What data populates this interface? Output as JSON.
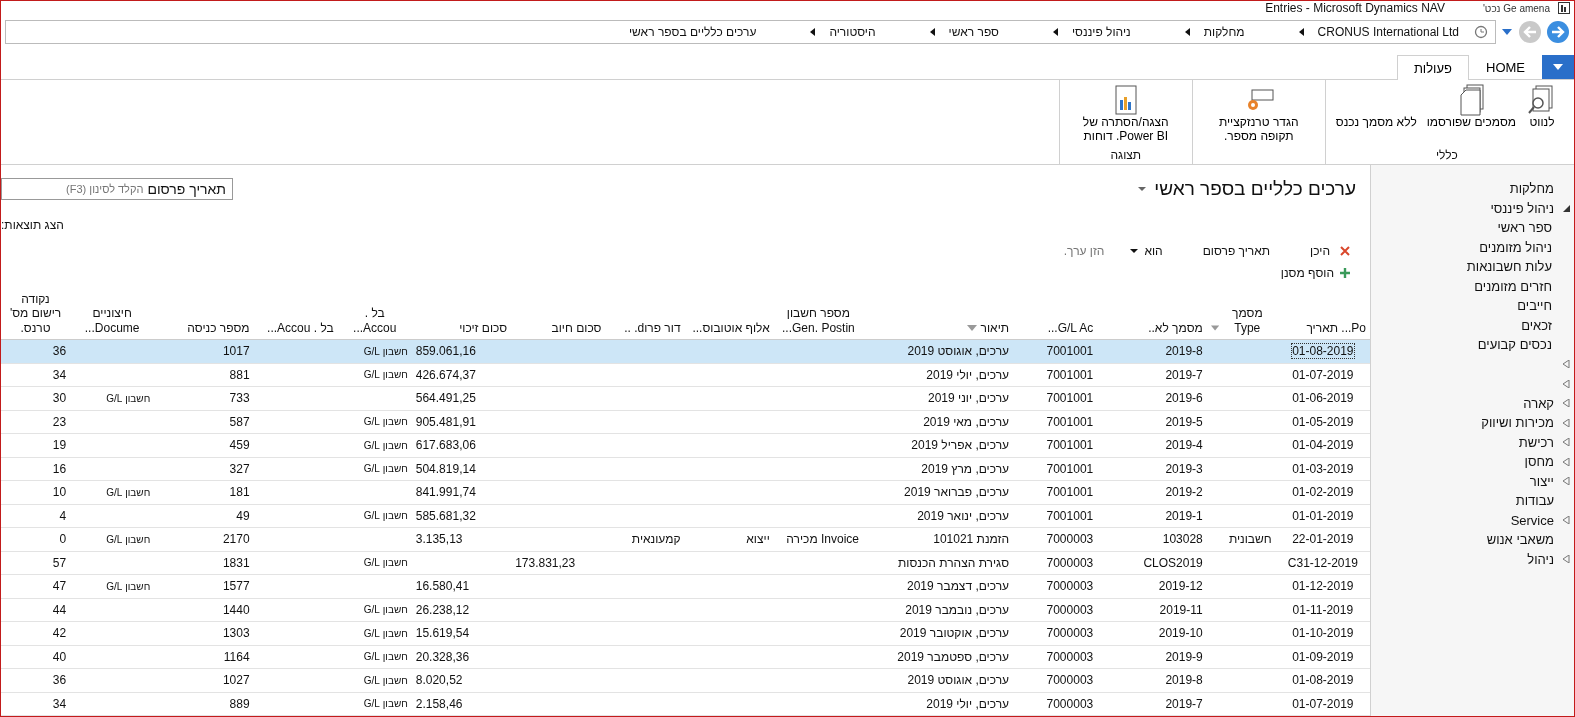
{
  "window": {
    "title": "Entries - Microsoft Dynamics NAV",
    "subtitle": "Ge amena נכט'"
  },
  "address_bar": {
    "crumbs": [
      "CRONUS International Ltd",
      "מחלקות",
      "ניהול פיננסי",
      "ספר ראשי",
      "היסטוריה",
      "ערכים כלליים בספר ראשי"
    ]
  },
  "ribbon": {
    "tabs": [
      {
        "label": "HOME",
        "selected": false
      },
      {
        "label": "פעולות",
        "selected": true
      }
    ],
    "groups": [
      {
        "label": "כללי",
        "buttons": [
          {
            "label": "לנווט"
          },
          {
            "label": "מסמכים שפורסמו"
          },
          {
            "label": "ללא מסמך נכנס"
          }
        ]
      },
      {
        "buttons": [
          {
            "label": "הגדר טרנזקציית תקופה מספר."
          }
        ]
      },
      {
        "label": "תצוגה",
        "buttons": [
          {
            "label": "הצגה/הסתרה של Power BI. דוחות"
          }
        ]
      }
    ]
  },
  "page": {
    "title": "ערכים כלליים בספר ראשי",
    "search": {
      "placeholder": "הקלד לסינון (F3)",
      "field": "תאריך פרסום"
    },
    "show_results": "הצג תוצאות:",
    "filter": {
      "where": "היכן",
      "field": "תאריך פרסום",
      "operator": "הוא",
      "value_placeholder": "הזן ערך.",
      "add": "הוסף מסנן"
    }
  },
  "table": {
    "columns": [
      {
        "label": "Po... תאריך",
        "sorted": false
      },
      {
        "label": "מסמך Type",
        "sorted": true
      },
      {
        "label": "מסמך לא..",
        "sorted": false
      },
      {
        "label": "G/L Ac...",
        "sorted": false
      },
      {
        "label": "תיאור",
        "sorted": true
      },
      {
        "label": "מספר חשבון Gen. Postin...",
        "sorted": false
      },
      {
        "label": "אלוף אוטובוס...",
        "sorted": false
      },
      {
        "label": "דור פרוd. ..",
        "sorted": false
      },
      {
        "label": "סכום חיוב",
        "sorted": false
      },
      {
        "label": "סכום זיכוי",
        "sorted": false
      },
      {
        "label": "בל . Accou...",
        "sorted": false
      },
      {
        "label": "בל . Accou...",
        "sorted": false
      },
      {
        "label": "מספר כניסה",
        "sorted": false
      },
      {
        "label": "חיצוניים Docume...",
        "sorted": false
      },
      {
        "label": "נקודה רישום מס' טרנס.",
        "sorted": false
      }
    ],
    "rows": [
      {
        "selected": true,
        "cells": [
          "01-08-2019",
          "",
          "2019-8",
          "7001001",
          "ערכים, אוגוסט 2019",
          "",
          "",
          "",
          "",
          "859.061,16",
          "חשבון G/L",
          "",
          "1017",
          "",
          "36"
        ]
      },
      {
        "selected": false,
        "cells": [
          "01-07-2019",
          "",
          "2019-7",
          "7001001",
          "ערכים, יולי 2019",
          "",
          "",
          "",
          "",
          "426.674,37",
          "חשבון G/L",
          "",
          "881",
          "",
          "34"
        ]
      },
      {
        "selected": false,
        "cells": [
          "01-06-2019",
          "",
          "2019-6",
          "7001001",
          "ערכים, יוני 2019",
          "",
          "",
          "",
          "",
          "564.491,25",
          "",
          "",
          "733",
          "חשבון G/L",
          "30"
        ]
      },
      {
        "selected": false,
        "cells": [
          "01-05-2019",
          "",
          "2019-5",
          "7001001",
          "ערכים, מאי 2019",
          "",
          "",
          "",
          "",
          "905.481,91",
          "חשבון G/L",
          "",
          "587",
          "",
          "23"
        ]
      },
      {
        "selected": false,
        "cells": [
          "01-04-2019",
          "",
          "2019-4",
          "7001001",
          "ערכים, אפריל 2019",
          "",
          "",
          "",
          "",
          "617.683,06",
          "חשבון G/L",
          "",
          "459",
          "",
          "19"
        ]
      },
      {
        "selected": false,
        "cells": [
          "01-03-2019",
          "",
          "2019-3",
          "7001001",
          "ערכים, מרץ 2019",
          "",
          "",
          "",
          "",
          "504.819,14",
          "חשבון G/L",
          "",
          "327",
          "",
          "16"
        ]
      },
      {
        "selected": false,
        "cells": [
          "01-02-2019",
          "",
          "2019-2",
          "7001001",
          "ערכים, פברואר 2019",
          "",
          "",
          "",
          "",
          "841.991,74",
          "",
          "",
          "181",
          "חשבון G/L",
          "10"
        ]
      },
      {
        "selected": false,
        "cells": [
          "01-01-2019",
          "",
          "2019-1",
          "7001001",
          "ערכים, ינואר 2019",
          "",
          "",
          "",
          "",
          "585.681,32",
          "חשבון G/L",
          "",
          "49",
          "",
          "4"
        ]
      },
      {
        "selected": false,
        "cells": [
          "22-01-2019",
          "חשבונית",
          "103028",
          "7000003",
          "הזמנת 101021",
          "Invoice מכירה",
          "ייצוא",
          "קמעונאית",
          "",
          "3.135,13",
          "",
          "",
          "2170",
          "חשבון G/L",
          "0"
        ]
      },
      {
        "selected": false,
        "cells": [
          "C31-12-2019",
          "",
          "CLOS2019",
          "7000003",
          "סגירת הצהרת הכנסות",
          "",
          "",
          "",
          "173.831,23",
          "",
          "חשבון G/L",
          "",
          "1831",
          "",
          "57"
        ]
      },
      {
        "selected": false,
        "cells": [
          "01-12-2019",
          "",
          "2019-12",
          "7000003",
          "ערכים, דצמבר 2019",
          "",
          "",
          "",
          "",
          "16.580,41",
          "",
          "",
          "1577",
          "חשבון G/L",
          "47"
        ]
      },
      {
        "selected": false,
        "cells": [
          "01-11-2019",
          "",
          "2019-11",
          "7000003",
          "ערכים, נובמבר 2019",
          "",
          "",
          "",
          "",
          "26.238,12",
          "חשבון G/L",
          "",
          "1440",
          "",
          "44"
        ]
      },
      {
        "selected": false,
        "cells": [
          "01-10-2019",
          "",
          "2019-10",
          "7000003",
          "ערכים, אוקטובר 2019",
          "",
          "",
          "",
          "",
          "15.619,54",
          "חשבון G/L",
          "",
          "1303",
          "",
          "42"
        ]
      },
      {
        "selected": false,
        "cells": [
          "01-09-2019",
          "",
          "2019-9",
          "7000003",
          "ערכים, ספטמבר 2019",
          "",
          "",
          "",
          "",
          "20.328,36",
          "חשבון G/L",
          "",
          "1164",
          "",
          "40"
        ]
      },
      {
        "selected": false,
        "cells": [
          "01-08-2019",
          "",
          "2019-8",
          "7000003",
          "ערכים, אוגוסט 2019",
          "",
          "",
          "",
          "",
          "8.020,52",
          "חשבון G/L",
          "",
          "1027",
          "",
          "36"
        ]
      },
      {
        "selected": false,
        "cells": [
          "01-07-2019",
          "",
          "2019-7",
          "7000003",
          "ערכים, יולי 2019",
          "",
          "",
          "",
          "",
          "2.158,46",
          "חשבון G/L",
          "",
          "889",
          "",
          "34"
        ]
      }
    ]
  },
  "sidebar": {
    "items": [
      {
        "label": "מחלקות"
      },
      {
        "label": "ניהול פיננסי",
        "expanded": true,
        "children": [
          {
            "label": "ספר ראשי"
          },
          {
            "label": "ניהול מזומנים"
          },
          {
            "label": "עלות חשבונאות"
          },
          {
            "label": "חזרים מזומנים"
          },
          {
            "label": "חייבים"
          },
          {
            "label": "זכאים"
          },
          {
            "label": "נכסים קבועים"
          }
        ]
      },
      {
        "expanded": false
      },
      {
        "expanded": false
      },
      {
        "label": "קארה",
        "expanded": false
      },
      {
        "label": "מכירות ושיווק",
        "expanded": false
      },
      {
        "label": "רכישת",
        "expanded": false
      },
      {
        "label": "מחסן",
        "expanded": false
      },
      {
        "label": "ייצור",
        "expanded": false
      },
      {
        "label": "עבודות"
      },
      {
        "label": "Service",
        "expanded": false
      },
      {
        "label": "משאבי אנוש"
      },
      {
        "label": "ניהול",
        "expanded": false
      }
    ]
  }
}
